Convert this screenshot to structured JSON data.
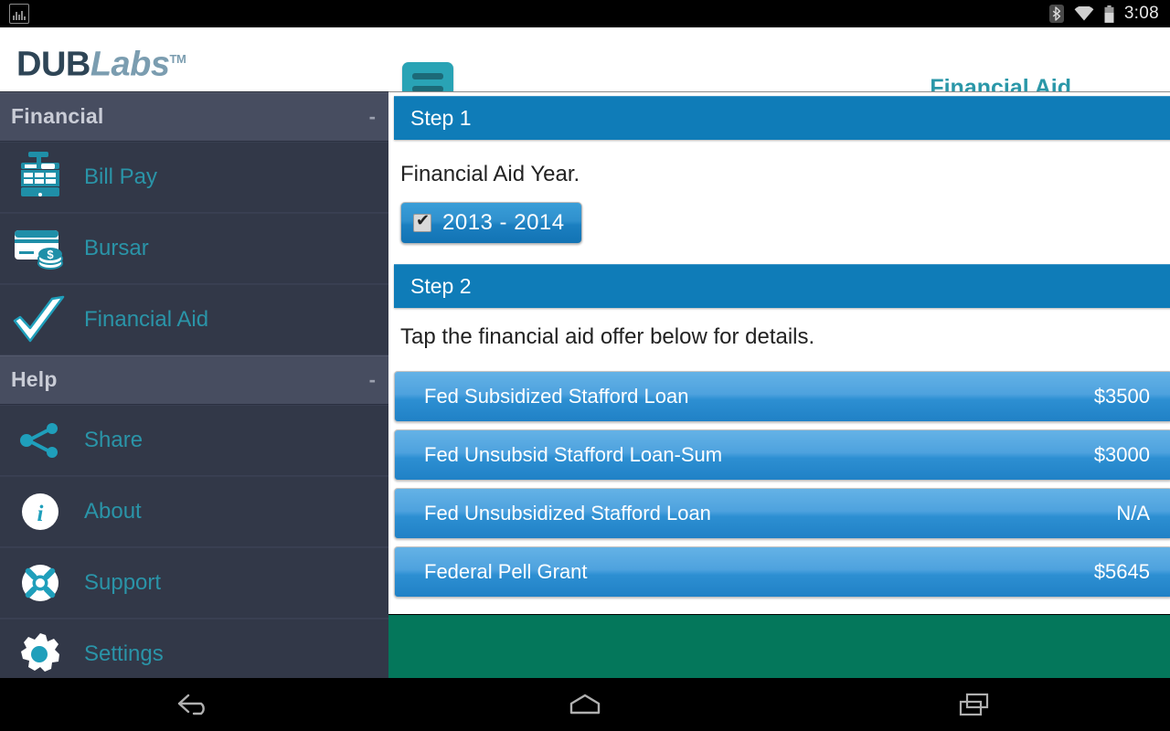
{
  "statusbar": {
    "time": "3:08",
    "icons": [
      "screenshot-icon",
      "bluetooth-icon",
      "wifi-icon",
      "battery-icon"
    ]
  },
  "brandbar": {
    "logo_dub": "DUB",
    "logo_labs": "Labs",
    "logo_tm": "TM",
    "menu_icon": "hamburger-menu-icon",
    "page_title": "Financial Aid"
  },
  "sidebar": {
    "sections": [
      {
        "title": "Financial",
        "collapse": "-",
        "items": [
          {
            "label": "Bill Pay",
            "icon": "cash-register-icon"
          },
          {
            "label": "Bursar",
            "icon": "credit-card-icon"
          },
          {
            "label": "Financial Aid",
            "icon": "checkmark-icon"
          }
        ]
      },
      {
        "title": "Help",
        "collapse": "-",
        "items": [
          {
            "label": "Share",
            "icon": "share-icon"
          },
          {
            "label": "About",
            "icon": "info-icon"
          },
          {
            "label": "Support",
            "icon": "life-ring-icon"
          },
          {
            "label": "Settings",
            "icon": "gear-icon"
          }
        ]
      }
    ]
  },
  "content": {
    "step1": {
      "header": "Step 1",
      "prompt": "Financial Aid Year.",
      "year_chip": {
        "label": "2013 - 2014",
        "checked": true
      }
    },
    "step2": {
      "header": "Step 2",
      "prompt": "Tap the financial aid offer below for details.",
      "offers": [
        {
          "name": "Fed Subsidized Stafford Loan",
          "amount": "$3500"
        },
        {
          "name": "Fed Unsubsid Stafford Loan-Sum",
          "amount": "$3000"
        },
        {
          "name": "Fed Unsubsidized Stafford Loan",
          "amount": "N/A"
        },
        {
          "name": "Federal Pell Grant",
          "amount": "$5645"
        }
      ]
    }
  },
  "navbar": {
    "buttons": [
      "back-icon",
      "home-icon",
      "recent-apps-icon"
    ]
  },
  "colors": {
    "brand_teal": "#2a97a8",
    "step_header_blue": "#0f7cb8",
    "offer_blue": "#2d8fd2",
    "sidebar_bg": "#323848",
    "sidebar_section_bg": "#474d60",
    "green_bar": "#04775b"
  }
}
